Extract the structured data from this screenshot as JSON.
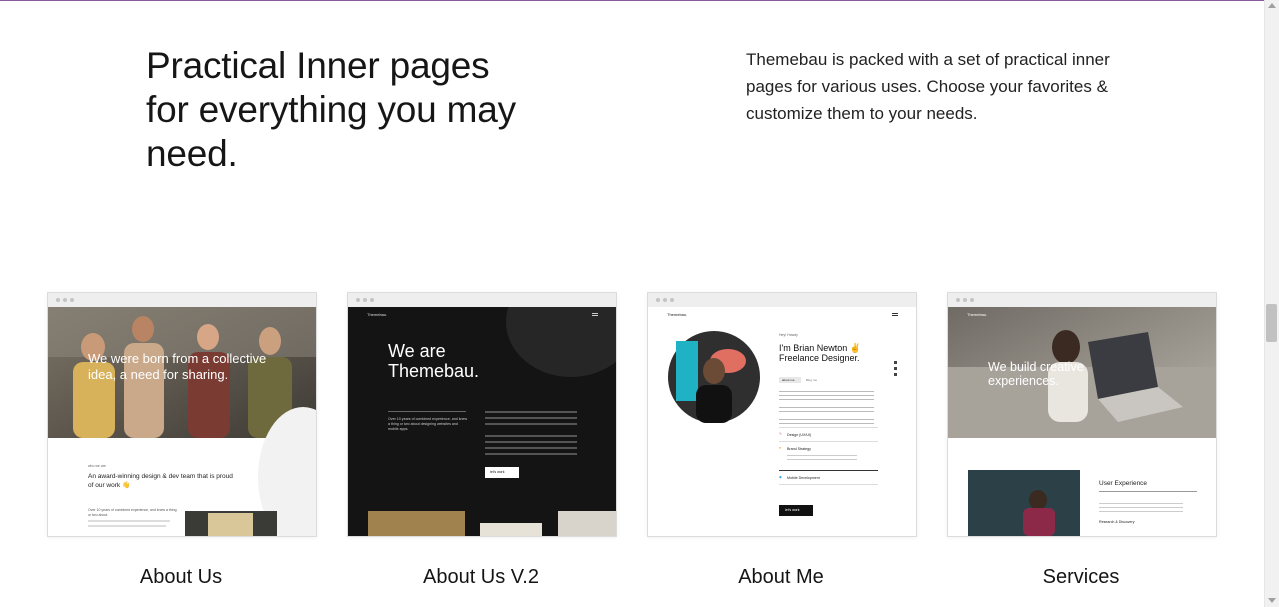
{
  "hero": {
    "title": "Practical Inner pages for everything you may need.",
    "description": "Themebau is packed with a set of practical inner pages for various uses. Choose your favorites & customize them to your needs."
  },
  "cards": [
    {
      "label": "About Us",
      "preview": {
        "headline": "We were born from a collective idea, a need for sharing.",
        "kicker": "who we are",
        "subheading": "An award-winning design & dev team that is proud of our work 👋",
        "body": "Over 10 years of combined experience, and knew a thing or two about."
      }
    },
    {
      "label": "About Us V.2",
      "preview": {
        "brand": "Themebau.",
        "headline": "We are Themebau.",
        "body": "Over 10 years of combined experience, and knew a thing or two about designing websites and mobile apps.",
        "button": "let's work"
      }
    },
    {
      "label": "About Me",
      "preview": {
        "brand": "Themebau.",
        "kicker": "Hey! Howdy",
        "headline": "I'm Brian Newton ✌️ Freelance Designer.",
        "tabs": [
          "about me",
          "Blog me"
        ],
        "items": [
          "Design (UX/UI)",
          "Brand Strategy",
          "Mobile Development"
        ],
        "button": "let's work"
      }
    },
    {
      "label": "Services",
      "preview": {
        "brand": "Themebau.",
        "headline": "We build creative experiences.",
        "section": "User Experience",
        "item": "Research & Discovery"
      }
    }
  ],
  "colors": {
    "accent_line": "#8b5a9e",
    "dark_panel": "#161616"
  }
}
